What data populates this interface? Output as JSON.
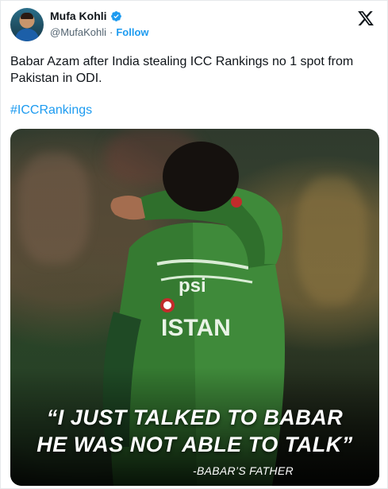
{
  "author": {
    "name": "Mufa Kohli",
    "handle": "@MufaKohli",
    "separator": "·",
    "follow_label": "Follow"
  },
  "tweet": {
    "text": "Babar Azam after India stealing ICC Rankings no 1 spot from Pakistan in ODI.",
    "hashtag": "#ICCRankings"
  },
  "media": {
    "quote_line1": "“I JUST TALKED TO BABAR",
    "quote_line2": "HE WAS NOT ABLE TO TALK”",
    "attribution": "-BABAR’S FATHER",
    "jersey_text1": "psi",
    "jersey_text2": "ISTAN"
  },
  "colors": {
    "link": "#1d9bf0",
    "jersey_green": "#3f8a3a",
    "jersey_dark": "#1f4a25"
  },
  "icons": [
    "verified-badge-icon",
    "x-logo-icon"
  ]
}
